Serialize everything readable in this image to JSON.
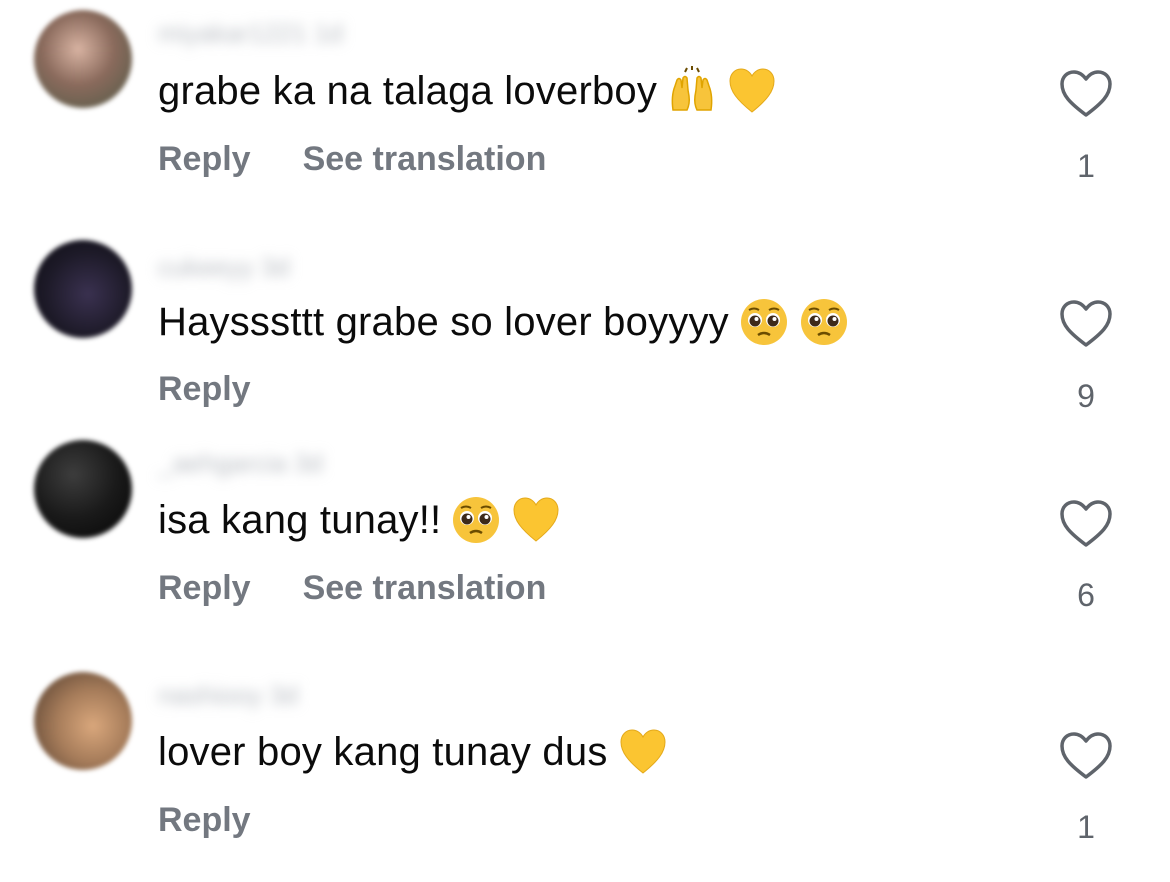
{
  "comments": [
    {
      "username": "miyakar1221",
      "time": "1d",
      "text": "grabe ka na talaga loverboy",
      "emojis": [
        "raising-hands",
        "yellow-heart"
      ],
      "actions": [
        "Reply",
        "See translation"
      ],
      "likes": "1",
      "avatar_color": "#8a6a5c"
    },
    {
      "username": "cukeeyy",
      "time": "3d",
      "text": "Haysssttt grabe so lover boyyyy",
      "emojis": [
        "pleading-face",
        "pleading-face"
      ],
      "actions": [
        "Reply"
      ],
      "likes": "9",
      "avatar_color": "#201c2c"
    },
    {
      "username": "_aehgarcia",
      "time": "3d",
      "text": "isa kang tunay!!",
      "emojis": [
        "pleading-face",
        "yellow-heart"
      ],
      "actions": [
        "Reply",
        "See translation"
      ],
      "likes": "6",
      "avatar_color": "#161616"
    },
    {
      "username": "nashiooy",
      "time": "3d",
      "text": "lover boy kang tunay dus",
      "emojis": [
        "yellow-heart"
      ],
      "actions": [
        "Reply"
      ],
      "likes": "1",
      "avatar_color": "#a67c5a"
    }
  ],
  "colors": {
    "text": "#0b0b0b",
    "secondary": "#737880",
    "heart_outline": "#5f646b",
    "emoji_yellow": "#f7c43b",
    "heart_yellow": "#fbc531"
  }
}
